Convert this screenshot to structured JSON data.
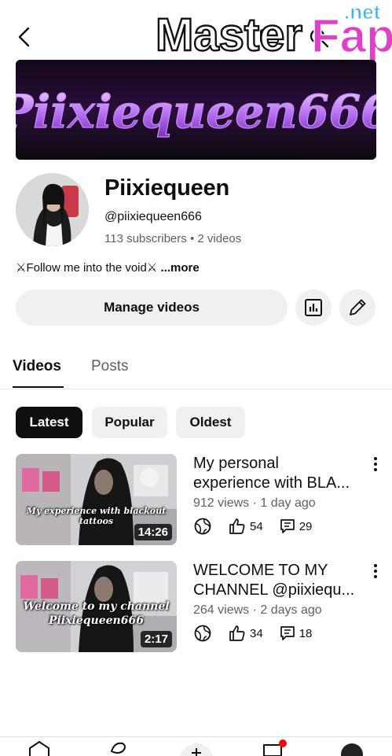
{
  "watermark": {
    "main": "Master",
    "brand": "Fap",
    "tld": ".net"
  },
  "banner": {
    "text": "Piixiequeen666"
  },
  "channel": {
    "name": "Piixiequeen",
    "handle": "@piixiequeen666",
    "stats": "113 subscribers  •  2 videos",
    "description": "⚔Follow me into the void⚔",
    "more": "...more"
  },
  "actions": {
    "manage_label": "Manage videos"
  },
  "tabs": [
    {
      "label": "Videos"
    },
    {
      "label": "Posts"
    }
  ],
  "chips": [
    {
      "label": "Latest"
    },
    {
      "label": "Popular"
    },
    {
      "label": "Oldest"
    }
  ],
  "videos": [
    {
      "title_line1": "My personal",
      "title_line2": "experience with BLA...",
      "meta": "912 views · 1 day ago",
      "likes": "54",
      "comments": "29",
      "duration": "14:26",
      "thumb_caption": "My experience with blackout tattoos"
    },
    {
      "title_line1": "WELCOME TO MY",
      "title_line2": "CHANNEL @piixiequ...",
      "meta": "264 views · 2 days ago",
      "likes": "34",
      "comments": "18",
      "duration": "2:17",
      "thumb_caption_1": "Welcome to my channel",
      "thumb_caption_2": "Piixiequeen666"
    }
  ],
  "colors": {
    "accent_dark": "#0f0f0f",
    "secondary_text": "#606060",
    "chip_bg": "#f0f0f0",
    "banner_purple": "#a14fe0"
  }
}
